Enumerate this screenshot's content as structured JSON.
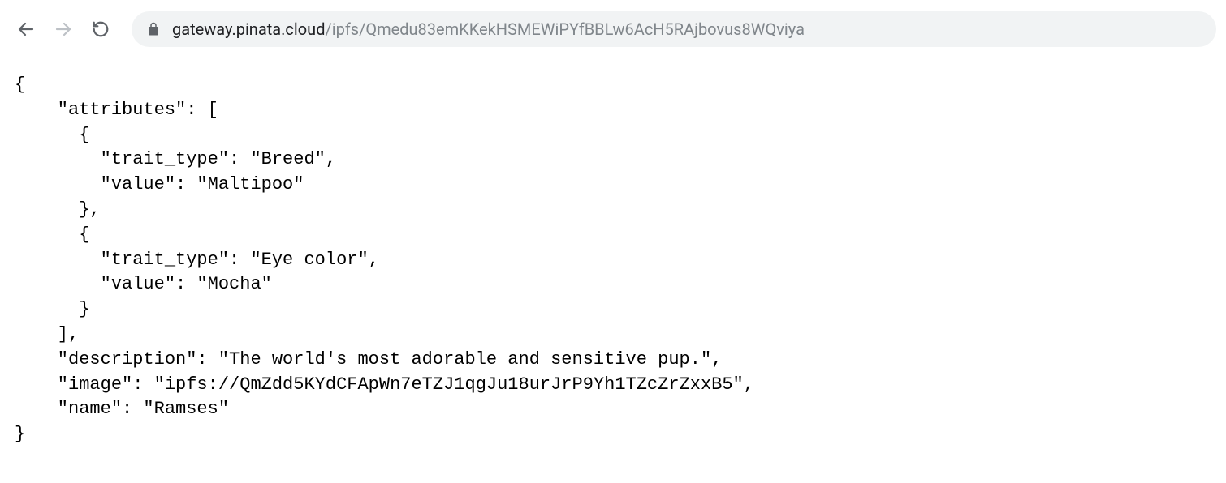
{
  "url": {
    "domain": "gateway.pinata.cloud",
    "path": "/ipfs/Qmedu83emKKekHSMEWiPYfBBLw6AcH5RAjbovus8WQviya"
  },
  "json": {
    "line1": "{",
    "line2": "    \"attributes\": [",
    "line3": "      {",
    "line4": "        \"trait_type\": \"Breed\",",
    "line5": "        \"value\": \"Maltipoo\"",
    "line6": "      },",
    "line7": "      {",
    "line8": "        \"trait_type\": \"Eye color\",",
    "line9": "        \"value\": \"Mocha\"",
    "line10": "      }",
    "line11": "    ],",
    "line12": "    \"description\": \"The world's most adorable and sensitive pup.\",",
    "line13": "    \"image\": \"ipfs://QmZdd5KYdCFApWn7eTZJ1qgJu18urJrP9Yh1TZcZrZxxB5\",",
    "line14": "    \"name\": \"Ramses\"",
    "line15": "}"
  }
}
